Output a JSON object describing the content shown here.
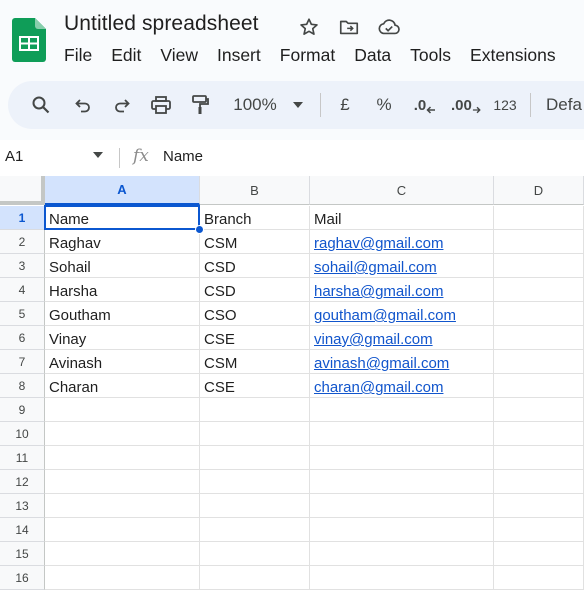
{
  "app": {
    "title": "Untitled spreadsheet",
    "title_icons": [
      "star-icon",
      "move-to-folder-icon",
      "cloud-saved-icon"
    ]
  },
  "menu": [
    "File",
    "Edit",
    "View",
    "Insert",
    "Format",
    "Data",
    "Tools",
    "Extensions"
  ],
  "toolbar": {
    "zoom": "100%",
    "currency": "£",
    "percent": "%",
    "decrease_decimal": ".0",
    "increase_decimal": ".00",
    "number_format": "123",
    "font": "Defa"
  },
  "formula_bar": {
    "name_box": "A1",
    "fx": "fx",
    "content": "Name"
  },
  "grid": {
    "columns": [
      "A",
      "B",
      "C",
      "D"
    ],
    "row_numbers": [
      "1",
      "2",
      "3",
      "4",
      "5",
      "6",
      "7",
      "8",
      "9",
      "10",
      "11",
      "12",
      "13",
      "14",
      "15",
      "16"
    ],
    "rows": [
      [
        "Name",
        "Branch",
        "Mail"
      ],
      [
        "Raghav",
        "CSM",
        "raghav@gmail.com"
      ],
      [
        "Sohail",
        "CSD",
        "sohail@gmail.com"
      ],
      [
        "Harsha",
        "CSD",
        "harsha@gmail.com"
      ],
      [
        "Goutham",
        "CSO",
        "goutham@gmail.com"
      ],
      [
        "Vinay",
        "CSE",
        "vinay@gmail.com"
      ],
      [
        "Avinash",
        "CSM",
        "avinash@gmail.com"
      ],
      [
        "Charan",
        "CSE",
        "charan@gmail.com"
      ]
    ],
    "selected_cell": "A1"
  },
  "colors": {
    "accent": "#0b57d0",
    "link": "#1155cc",
    "sheets_green": "#0f9d58",
    "toolbar_bg": "#edf2fa"
  }
}
